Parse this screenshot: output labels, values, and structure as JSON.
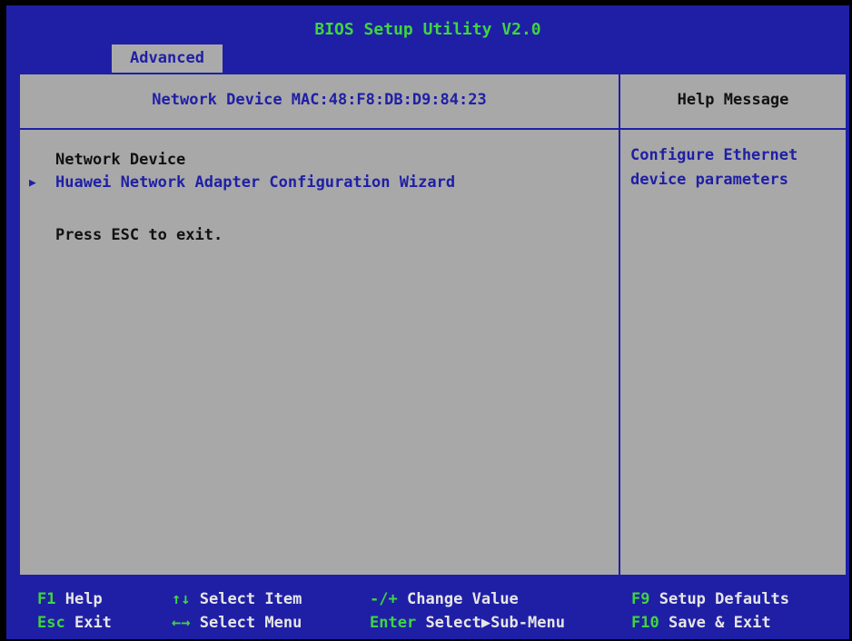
{
  "title": "BIOS Setup Utility V2.0",
  "active_tab": "Advanced",
  "main_header": "Network Device MAC:48:F8:DB:D9:84:23",
  "help_header": "Help Message",
  "items": {
    "network_device": "Network Device",
    "wizard": "Huawei Network Adapter Configuration Wizard",
    "esc_hint": "Press ESC to exit."
  },
  "submenu_marker": "▶",
  "help_text": "Configure Ethernet\ndevice parameters",
  "footer": {
    "f1_key": "F1",
    "f1_label": "Help",
    "updown_key": "↑↓",
    "updown_label": "Select Item",
    "plusminus_key": "-/+",
    "plusminus_label": "Change Value",
    "f9_key": "F9",
    "f9_label": "Setup Defaults",
    "esc_key": "Esc",
    "esc_label": "Exit",
    "leftright_key": "←→",
    "leftright_label": "Select Menu",
    "enter_key": "Enter",
    "enter_label": "Select▶Sub-Menu",
    "f10_key": "F10",
    "f10_label": "Save & Exit"
  },
  "colors": {
    "frame": "#1f1fa6",
    "panel": "#a8a8a8",
    "title": "#3fd53f",
    "help_text": "#1f1fa6"
  }
}
